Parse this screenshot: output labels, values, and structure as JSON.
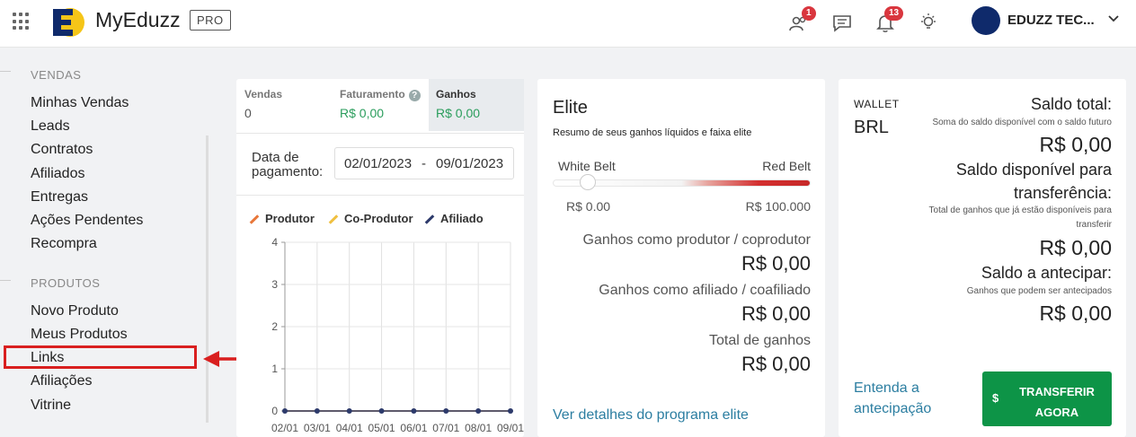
{
  "header": {
    "brand": "MyEduzz",
    "plan_badge": "PRO",
    "affiliates_badge": "1",
    "notifications_badge": "13",
    "user_name": "EDUZZ TEC...",
    "icons": [
      "apps-grid-icon",
      "people-icon",
      "chat-icon",
      "bell-icon",
      "lightbulb-icon",
      "chevron-down-icon"
    ]
  },
  "sidebar": {
    "sections": [
      {
        "title": "VENDAS",
        "items": [
          "Minhas Vendas",
          "Leads",
          "Contratos",
          "Afiliados",
          "Entregas",
          "Ações Pendentes",
          "Recompra"
        ]
      },
      {
        "title": "PRODUTOS",
        "items": [
          "Novo Produto",
          "Meus Produtos",
          "Links",
          "Afiliações",
          "Vitrine"
        ]
      }
    ],
    "highlighted_item": "Links",
    "highlight_color": "#d91f1f"
  },
  "stats": {
    "tabs": [
      {
        "label": "Vendas",
        "value": "0"
      },
      {
        "label": "Faturamento",
        "value": "R$ 0,00"
      },
      {
        "label": "Ganhos",
        "value": "R$ 0,00"
      }
    ],
    "help_icon": "?",
    "date_label": "Data de pagamento:",
    "date_start": "02/01/2023",
    "date_sep": "-",
    "date_end": "09/01/2023",
    "legend": [
      {
        "name": "Produtor",
        "color": "#e8773a"
      },
      {
        "name": "Co-Produtor",
        "color": "#f0c040"
      },
      {
        "name": "Afiliado",
        "color": "#2d3a6b"
      }
    ]
  },
  "chart_data": {
    "type": "line",
    "categories": [
      "02/01",
      "03/01",
      "04/01",
      "05/01",
      "06/01",
      "07/01",
      "08/01",
      "09/01"
    ],
    "series": [
      {
        "name": "Produtor",
        "values": [
          0,
          0,
          0,
          0,
          0,
          0,
          0,
          0
        ]
      },
      {
        "name": "Co-Produtor",
        "values": [
          0,
          0,
          0,
          0,
          0,
          0,
          0,
          0
        ]
      },
      {
        "name": "Afiliado",
        "values": [
          0,
          0,
          0,
          0,
          0,
          0,
          0,
          0
        ]
      }
    ],
    "y_ticks": [
      "0",
      "1",
      "2",
      "3",
      "4"
    ],
    "ylim": [
      0,
      4
    ],
    "grid": true
  },
  "elite": {
    "title": "Elite",
    "subtitle": "Resumo de seus ganhos líquidos e faixa elite",
    "belt_left": "White Belt",
    "belt_right": "Red Belt",
    "belt_min": "R$ 0.00",
    "belt_max": "R$ 100.000",
    "rows": [
      {
        "label": "Ganhos como produtor / coprodutor",
        "value": "R$ 0,00"
      },
      {
        "label": "Ganhos como afiliado / coafiliado",
        "value": "R$ 0,00"
      },
      {
        "label": "Total de ganhos",
        "value": "R$ 0,00"
      }
    ],
    "link": "Ver detalhes do programa elite"
  },
  "wallet": {
    "label": "WALLET",
    "currency": "BRL",
    "saldo_total_label": "Saldo total:",
    "saldo_total_desc": "Soma do saldo disponível com o saldo futuro",
    "saldo_total_value": "R$ 0,00",
    "disponivel_label_1": "Saldo disponível para",
    "disponivel_label_2": "transferência:",
    "disponivel_desc_1": "Total de ganhos que já estão disponíveis para",
    "disponivel_desc_2": "transferir",
    "disponivel_value": "R$ 0,00",
    "antecipar_label": "Saldo a antecipar:",
    "antecipar_desc": "Ganhos que podem ser antecipados",
    "antecipar_value": "R$ 0,00",
    "entenda_link_1": "Entenda a",
    "entenda_link_2": "antecipação",
    "transfer_button_symbol": "$",
    "transfer_button_1": "TRANSFERIR",
    "transfer_button_2": "AGORA",
    "button_color": "#0d9447"
  }
}
